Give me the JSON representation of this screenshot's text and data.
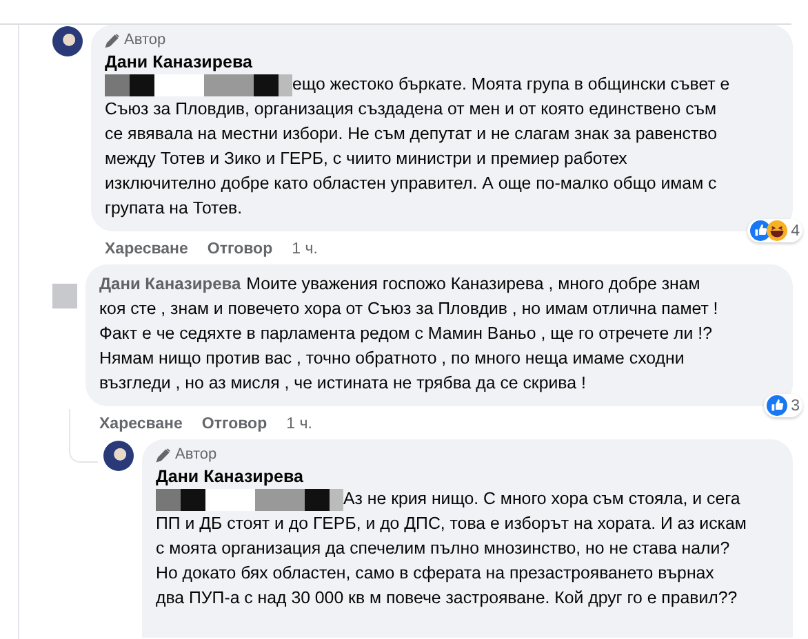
{
  "comments": [
    {
      "avatar": {
        "kind": "photo"
      },
      "badge": "Автор",
      "author": "Дани Каназирева",
      "redacted": true,
      "text": "ещо жестоко бъркате. Моята група в общински съвет е\nСъюз за Пловдив, организация създадена от мен и от която единствено съм\nсе явявала на местни избори. Не съм депутат и не слагам знак за равенство\nмежду Тотев и Зико и ГЕРБ, с чиито министри и премиер работех\nизключително добре като областен управител. А още по-малко общо имам с\nгрупата на Тотев.",
      "nested": false,
      "reactions": [
        {
          "kind": "like"
        },
        {
          "kind": "haha"
        }
      ],
      "reaction_count": "4",
      "actions": [
        "Харесване",
        "Отговор"
      ],
      "time": "1 ч."
    },
    {
      "avatar": {
        "kind": "blank"
      },
      "mention": "Дани Каназирева",
      "redacted": false,
      "text": "Моите уважения госпожо Каназирева , много добре знам\nкоя сте , знам и повечето хора от Съюз за Пловдив , но имам отлична памет !\nФакт е че седяхте в парламента редом с Мамин Ваньо , ще го отречете ли !?\nНямам нищо против вас , точно обратното , по много неща имаме сходни\nвъзгледи , но аз мисля , че истината не трябва да се скрива !",
      "nested": false,
      "reactions": [
        {
          "kind": "like"
        }
      ],
      "reaction_count": "3",
      "actions": [
        "Харесване",
        "Отговор"
      ],
      "time": "1 ч."
    },
    {
      "avatar": {
        "kind": "photo"
      },
      "badge": "Автор",
      "author": "Дани Каназирева",
      "redacted": true,
      "text": "Аз не крия нищо. С много хора съм стояла, и сега\nПП и ДБ стоят и до ГЕРБ, и до ДПС, това е изборът на хората. И аз искам\nс моята организация да спечелим пълно мнозинство, но не става нали?\nНо докато бях областен, само в сферата на презастрояването върнах\nдва ПУП-а с над 30 000 кв м повече застрояване. Кой друг го е правил??",
      "nested": true
    }
  ]
}
